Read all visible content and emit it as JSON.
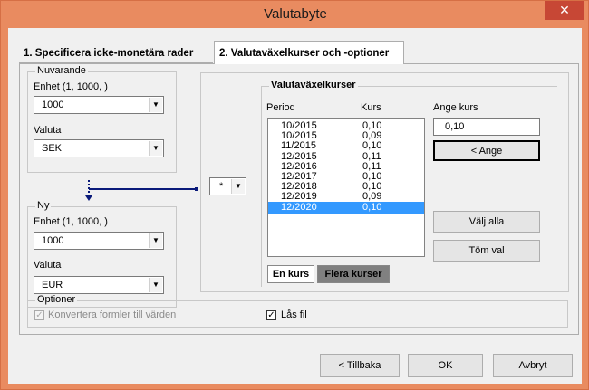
{
  "window": {
    "title": "Valutabyte",
    "close_glyph": "✕"
  },
  "tabs": [
    {
      "label": "1. Specificera icke-monetära rader",
      "active": false
    },
    {
      "label": "2. Valutaväxelkurser och -optioner",
      "active": true
    }
  ],
  "current": {
    "group_label": "Nuvarande",
    "unit_label": "Enhet (1, 1000, )",
    "unit_value": "1000",
    "currency_label": "Valuta",
    "currency_value": "SEK"
  },
  "new": {
    "group_label": "Ny",
    "unit_label": "Enhet (1, 1000, )",
    "unit_value": "1000",
    "currency_label": "Valuta",
    "currency_value": "EUR"
  },
  "operator": {
    "value": "*"
  },
  "rates": {
    "group_label": "Valutaväxelkurser",
    "col_period": "Period",
    "col_rate": "Kurs",
    "rows": [
      {
        "period": "10/2015",
        "rate": "0,10",
        "selected": false
      },
      {
        "period": "10/2015",
        "rate": "0,09",
        "selected": false
      },
      {
        "period": "11/2015",
        "rate": "0,10",
        "selected": false
      },
      {
        "period": "12/2015",
        "rate": "0,11",
        "selected": false
      },
      {
        "period": "12/2016",
        "rate": "0,11",
        "selected": false
      },
      {
        "period": "12/2017",
        "rate": "0,10",
        "selected": false
      },
      {
        "period": "12/2018",
        "rate": "0,10",
        "selected": false
      },
      {
        "period": "12/2019",
        "rate": "0,09",
        "selected": false
      },
      {
        "period": "12/2020",
        "rate": "0,10",
        "selected": true
      }
    ],
    "enter_rate_label": "Ange kurs",
    "enter_rate_value": "0,10",
    "enter_button": "< Ange",
    "select_all_button": "Välj alla",
    "clear_button": "Töm val",
    "single_rate_toggle": "En kurs",
    "multiple_rates_toggle": "Flera kurser"
  },
  "options": {
    "group_label": "Optioner",
    "convert_formulas_label": "Konvertera formler till värden",
    "convert_formulas_checked": true,
    "lock_file_label": "Lås fil",
    "lock_file_checked": true
  },
  "footer": {
    "back_button": "< Tillbaka",
    "ok_button": "OK",
    "cancel_button": "Avbryt"
  },
  "colors": {
    "title_bar": "#e98b60",
    "close_button": "#c74735",
    "selection": "#3399ff",
    "connector_line": "#0a1a7a"
  }
}
